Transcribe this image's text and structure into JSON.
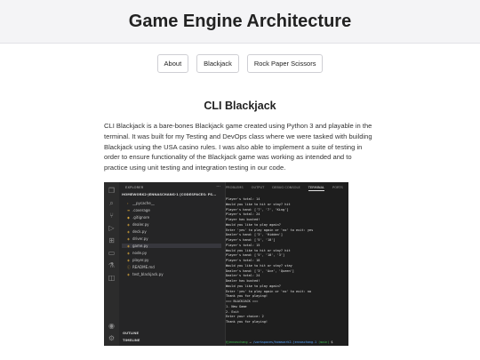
{
  "site": {
    "title": "Game Engine Architecture"
  },
  "nav": [
    "About",
    "Blackjack",
    "Rock Paper Scissors"
  ],
  "post": {
    "title": "CLI Blackjack",
    "intro": "CLI Blackjack is a bare-bones Blackjack game created using Python 3 and playable in the terminal. It was built for my Testing and DevOps class where we were tasked with building Blackjack using the USA casino rules. I was also able to implement a suite of testing in order to ensure functionality of the Blackjack game was working as intended and to practice using unit testing and integration testing in our code."
  },
  "ide": {
    "activity_icons": [
      "files-icon",
      "search-icon",
      "source-control-icon",
      "run-debug-icon",
      "extensions-icon",
      "remote-icon",
      "testing-icon",
      "docker-icon",
      "account-icon",
      "settings-icon"
    ],
    "explorer_label": "EXPLORER",
    "explorer_root": "HOMEWORK2-JENNASCHANG-1 [CODESPACES: PS...",
    "files": [
      "__pycache__",
      ".coverage",
      ".gitignore",
      "dealer.py",
      "deck.py",
      "driver.py",
      "game.py",
      "node.py",
      "player.py",
      "README.md",
      "test_blackjack.py"
    ],
    "selected_file": "game.py",
    "outline": "OUTLINE",
    "timeline": "TIMELINE",
    "panel_tabs": [
      "PROBLEMS",
      "OUTPUT",
      "DEBUG CONSOLE",
      "TERMINAL",
      "PORTS"
    ],
    "active_tab": "TERMINAL",
    "terminal_lines": [
      "Player's total: 14",
      "Would you like to hit or stay? hit",
      "Player's hand: ['7', '7', 'King']",
      "Player's total: 24",
      "Player has busted!",
      "Would you like to play again?",
      "Enter 'yes' to play again or 'no' to exit: yes",
      "Dealer's hand: ['3', 'Hidden']",
      "Player's hand: ['5', '10']",
      "Player's total: 15",
      "Would you like to hit or stay? hit",
      "Player's hand: ['5', '10', '3']",
      "Player's total: 18",
      "Would you like to hit or stay? stay",
      "Dealer's hand: ['3', 'Ace', 'Queen']",
      "Dealer's total: 24",
      "Dealer has busted!",
      "Would you like to play again?",
      "Enter 'yes' to play again or 'no' to exit: no",
      "Thank you for playing!",
      "=== BLACKJACK ===",
      "1. New Game",
      "2. Exit",
      "Enter your choice: 2",
      "Thank you for playing!"
    ],
    "prompt": {
      "user": "@jennaschang",
      "arrow": " → ",
      "path": "/workspaces/homework2-jennaschang-1",
      "branch": " (main) ",
      "end": "$ "
    }
  }
}
